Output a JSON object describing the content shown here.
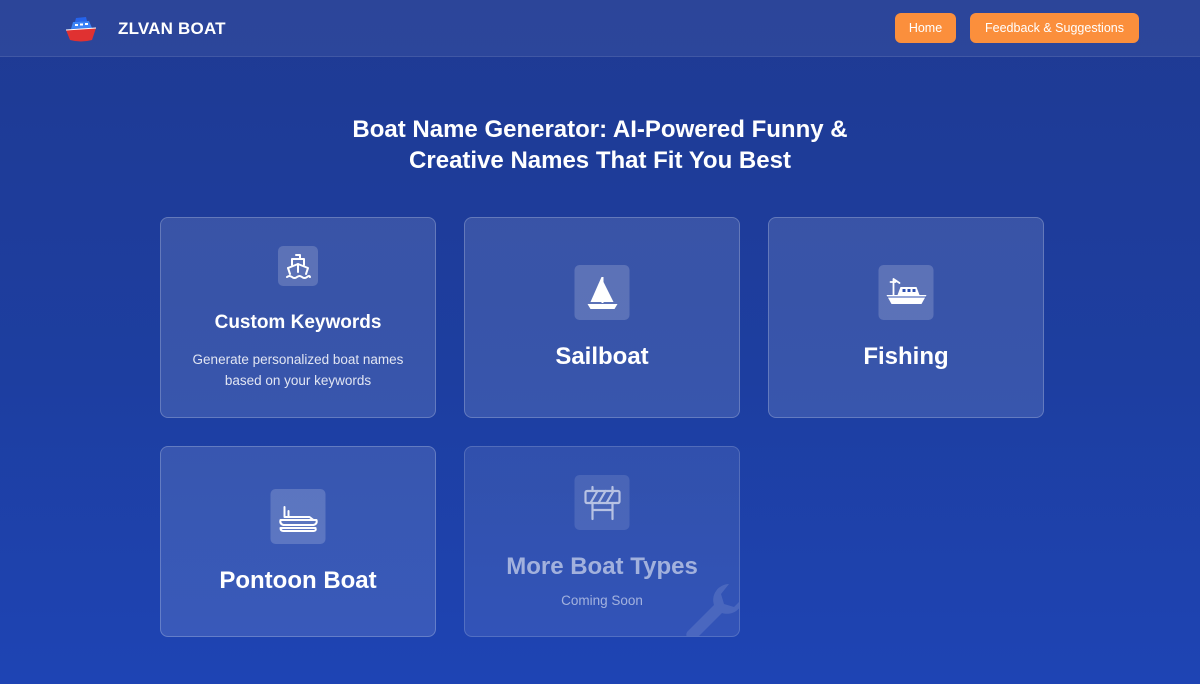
{
  "brand": {
    "name": "ZLVAN BOAT",
    "logo_icon": "boat-logo-icon"
  },
  "nav": {
    "home_label": "Home",
    "feedback_label": "Feedback & Suggestions"
  },
  "page": {
    "title_line1": "Boat Name Generator: AI-Powered Funny &",
    "title_line2": "Creative Names That Fit You Best"
  },
  "cards": [
    {
      "title": "Custom Keywords",
      "description_line1": "Generate personalized boat names",
      "description_line2": "based on your keywords",
      "icon": "ship-icon"
    },
    {
      "title": "Sailboat",
      "icon": "sailboat-icon"
    },
    {
      "title": "Fishing",
      "icon": "fishing-boat-icon"
    },
    {
      "title": "Pontoon Boat",
      "icon": "pontoon-boat-icon"
    },
    {
      "title": "More Boat Types",
      "subtitle": "Coming Soon",
      "icon": "barrier-icon"
    }
  ],
  "colors": {
    "accent": "#fb8f3c",
    "background_top": "#1f3a93",
    "background_bottom": "#1e44b4",
    "logo_red": "#e03131",
    "logo_blue": "#2f7ee8"
  }
}
